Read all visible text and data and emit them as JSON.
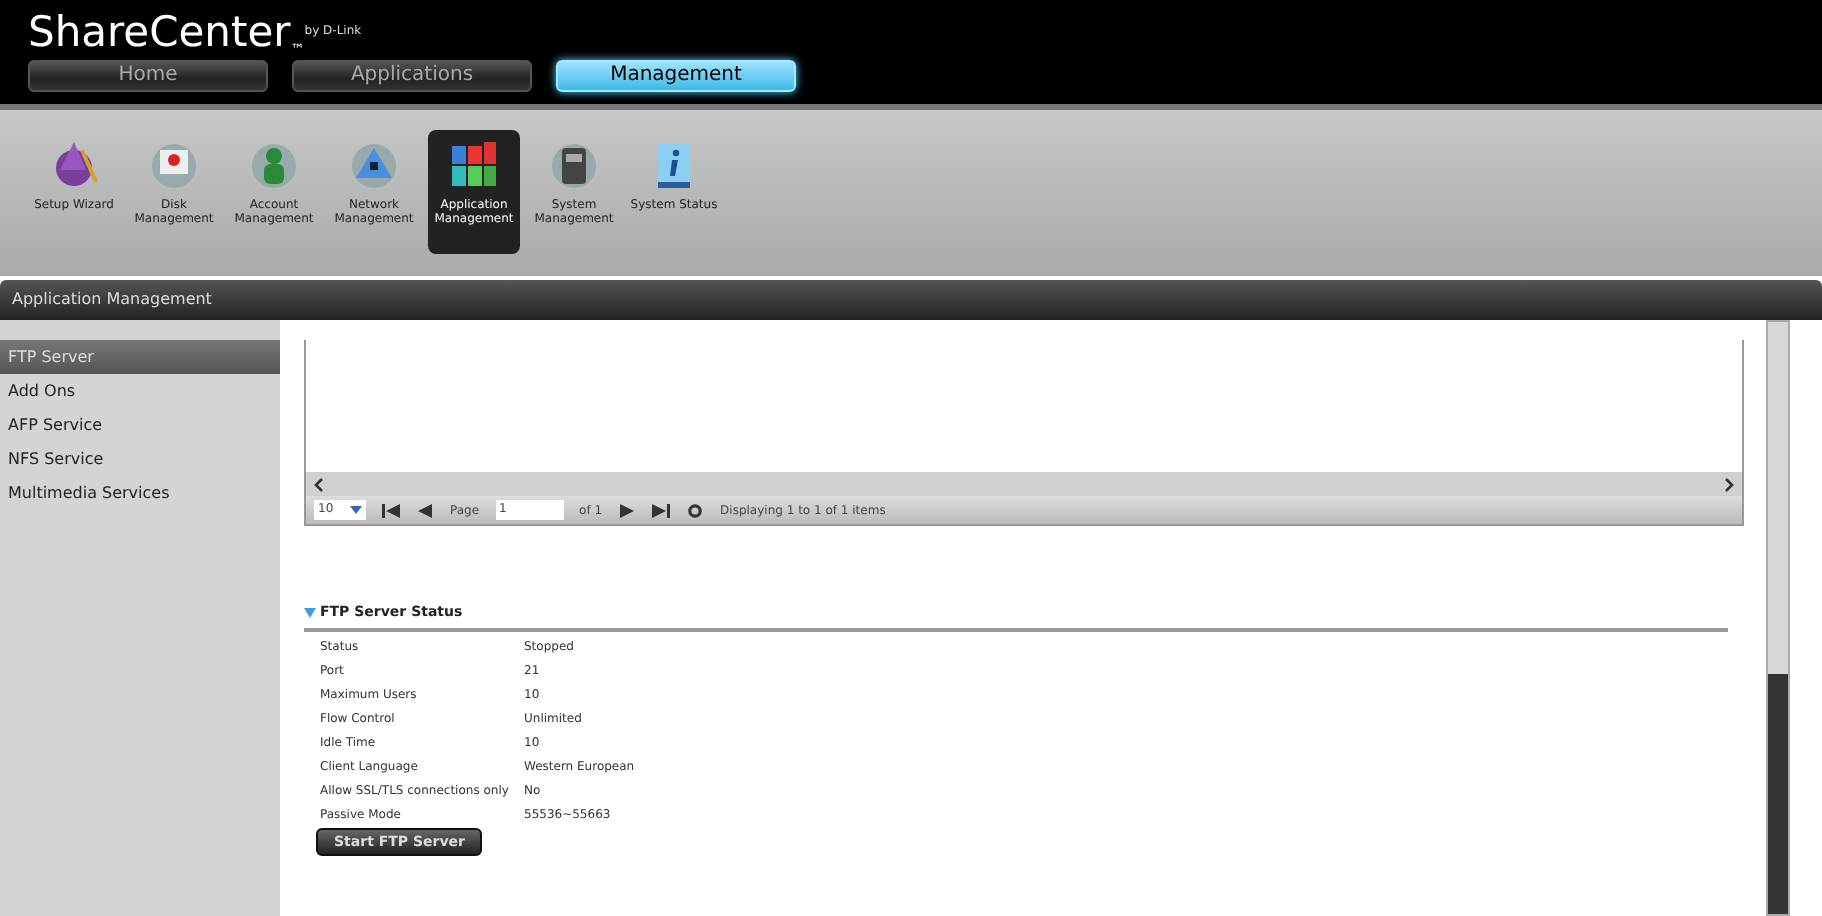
{
  "app": {
    "title": "ShareCenter",
    "trademark": "™",
    "byline": "by D-Link"
  },
  "tabs": [
    {
      "label": "Home",
      "selected": false
    },
    {
      "label": "Applications",
      "selected": false
    },
    {
      "label": "Management",
      "selected": true
    }
  ],
  "toolbar": [
    {
      "kind": "wizard",
      "lines": [
        "Setup Wizard"
      ],
      "selected": false
    },
    {
      "kind": "disk",
      "lines": [
        "Disk",
        "Management"
      ],
      "selected": false
    },
    {
      "kind": "account",
      "lines": [
        "Account",
        "Management"
      ],
      "selected": false
    },
    {
      "kind": "network",
      "lines": [
        "Network",
        "Management"
      ],
      "selected": false
    },
    {
      "kind": "application",
      "lines": [
        "Application",
        "Management"
      ],
      "selected": true
    },
    {
      "kind": "system",
      "lines": [
        "System",
        "Management"
      ],
      "selected": false
    },
    {
      "kind": "status",
      "lines": [
        "System Status"
      ],
      "selected": false
    }
  ],
  "section": {
    "title": "Application Management"
  },
  "sidebar": {
    "items": [
      {
        "label": "FTP Server",
        "selected": true
      },
      {
        "label": "Add Ons",
        "selected": false
      },
      {
        "label": "AFP Service",
        "selected": false
      },
      {
        "label": "NFS Service",
        "selected": false
      },
      {
        "label": "Multimedia Services",
        "selected": false
      }
    ]
  },
  "grid": {
    "page_size": "10",
    "page_label": "Page",
    "page": "1",
    "of_pages": "of 1",
    "summary": "Displaying 1 to 1 of 1 items"
  },
  "status_panel": {
    "title": "FTP Server Status",
    "expanded": true,
    "rows": [
      {
        "label": "Status",
        "value": "Stopped"
      },
      {
        "label": "Port",
        "value": "21"
      },
      {
        "label": "Maximum Users",
        "value": "10"
      },
      {
        "label": "Flow Control",
        "value": "Unlimited"
      },
      {
        "label": "Idle Time",
        "value": "10"
      },
      {
        "label": "Client Language",
        "value": "Western European"
      },
      {
        "label": "Allow SSL/TLS connections only",
        "value": "No"
      },
      {
        "label": "Passive Mode",
        "value": "55536~55663"
      }
    ],
    "button": "Start FTP Server"
  }
}
